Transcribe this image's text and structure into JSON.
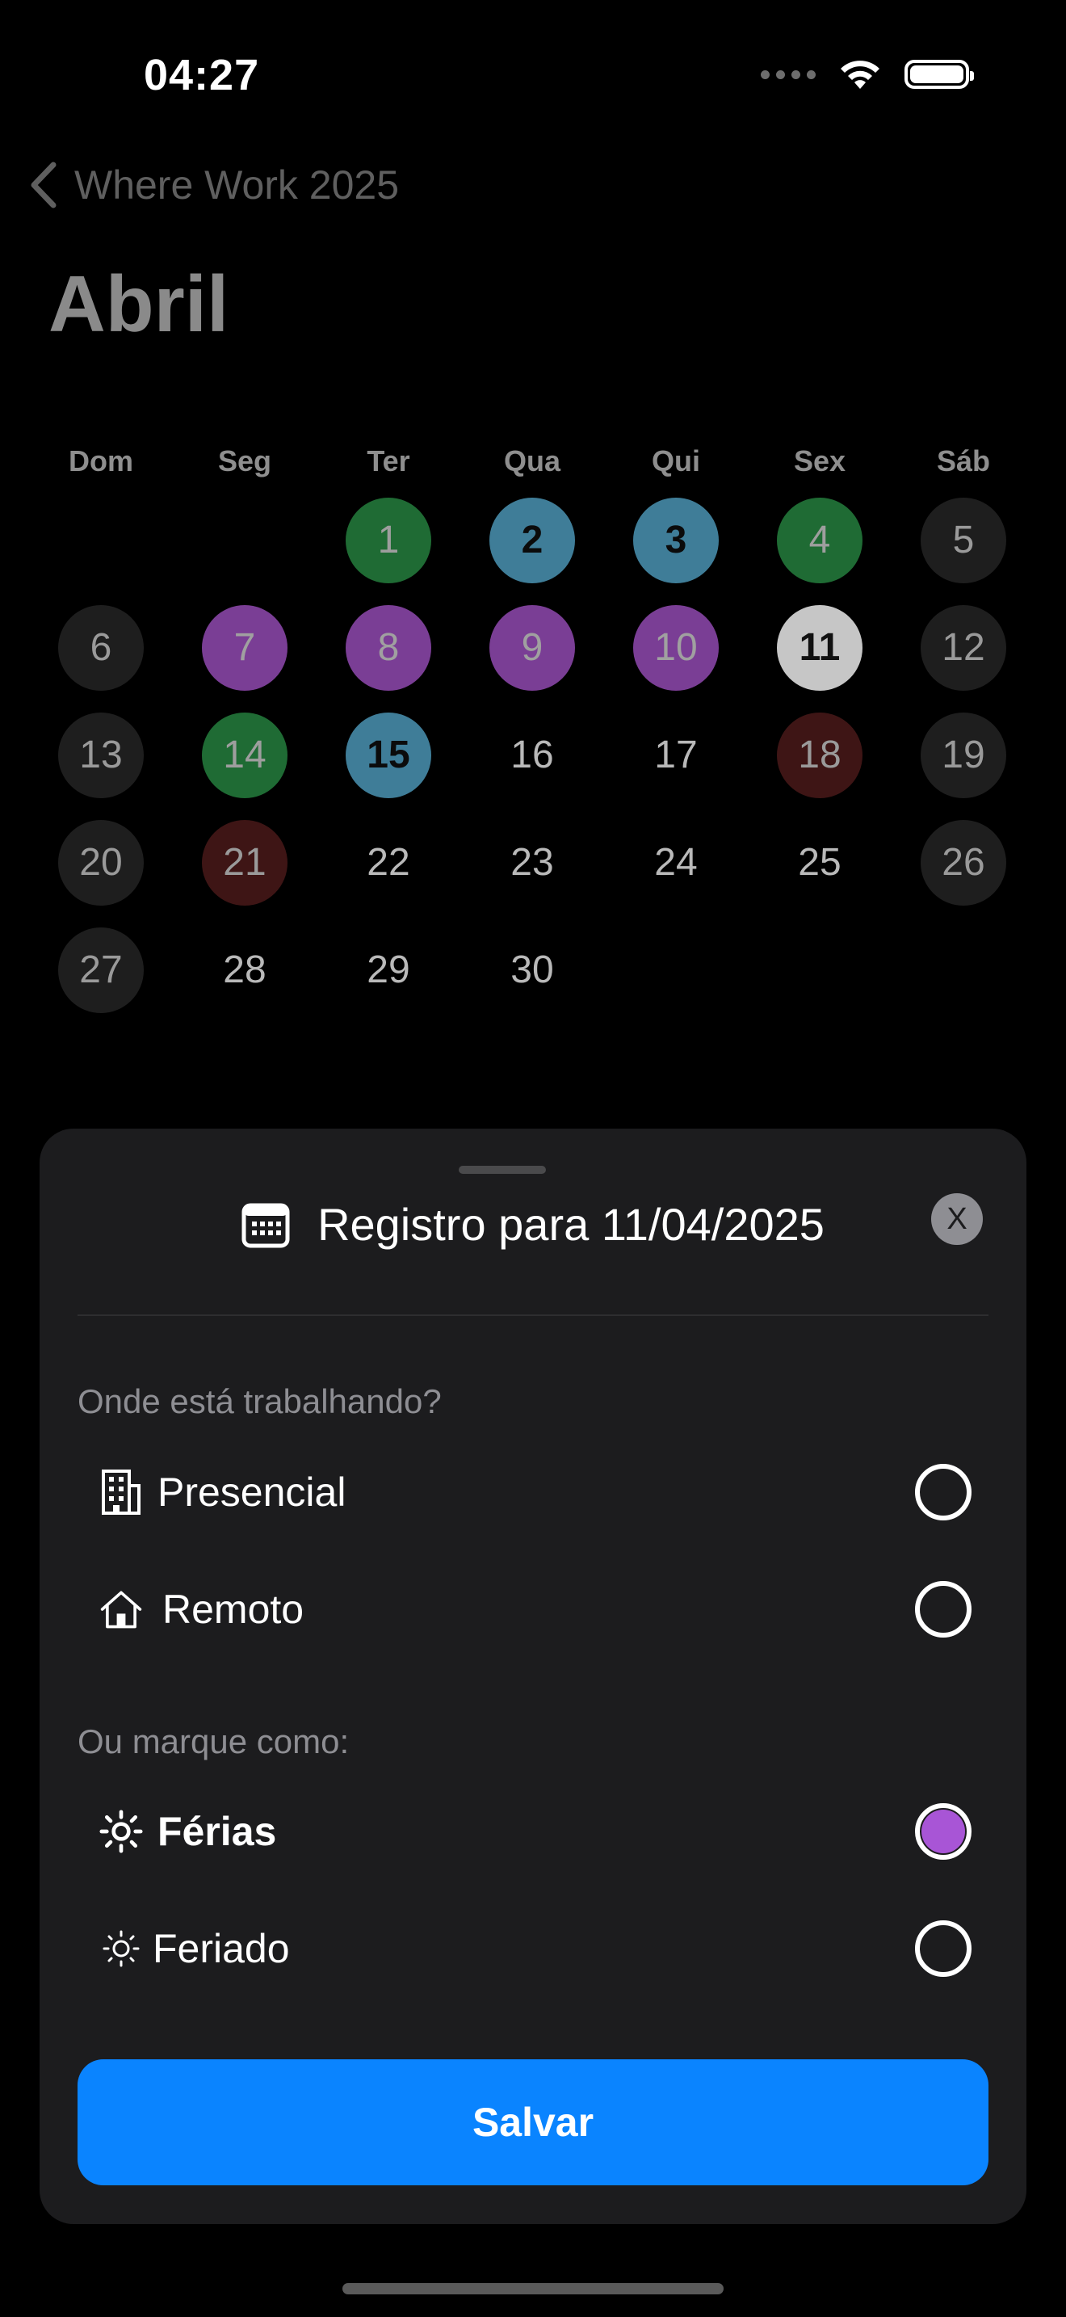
{
  "status_bar": {
    "time": "04:27"
  },
  "nav": {
    "back_label": "Where Work 2025",
    "title": "Abril"
  },
  "calendar": {
    "weekdays": [
      "Dom",
      "Seg",
      "Ter",
      "Qua",
      "Qui",
      "Sex",
      "Sáb"
    ],
    "days": [
      {
        "n": "",
        "s": "empty"
      },
      {
        "n": "",
        "s": "empty"
      },
      {
        "n": "1",
        "s": "green"
      },
      {
        "n": "2",
        "s": "teal"
      },
      {
        "n": "3",
        "s": "teal"
      },
      {
        "n": "4",
        "s": "green"
      },
      {
        "n": "5",
        "s": "weekend"
      },
      {
        "n": "6",
        "s": "weekend"
      },
      {
        "n": "7",
        "s": "purple"
      },
      {
        "n": "8",
        "s": "purple"
      },
      {
        "n": "9",
        "s": "purple"
      },
      {
        "n": "10",
        "s": "purple"
      },
      {
        "n": "11",
        "s": "today"
      },
      {
        "n": "12",
        "s": "weekend"
      },
      {
        "n": "13",
        "s": "weekend"
      },
      {
        "n": "14",
        "s": "green"
      },
      {
        "n": "15",
        "s": "teal"
      },
      {
        "n": "16",
        "s": "plain"
      },
      {
        "n": "17",
        "s": "plain"
      },
      {
        "n": "18",
        "s": "red"
      },
      {
        "n": "19",
        "s": "weekend"
      },
      {
        "n": "20",
        "s": "weekend"
      },
      {
        "n": "21",
        "s": "red"
      },
      {
        "n": "22",
        "s": "plain"
      },
      {
        "n": "23",
        "s": "plain"
      },
      {
        "n": "24",
        "s": "plain"
      },
      {
        "n": "25",
        "s": "plain"
      },
      {
        "n": "26",
        "s": "weekend"
      },
      {
        "n": "27",
        "s": "weekend"
      },
      {
        "n": "28",
        "s": "plain"
      },
      {
        "n": "29",
        "s": "plain"
      },
      {
        "n": "30",
        "s": "plain"
      }
    ]
  },
  "sheet": {
    "title": "Registro para 11/04/2025",
    "close_label": "X",
    "work_question": "Onde está trabalhando?",
    "work_options": [
      {
        "label": "Presencial",
        "icon": "building-icon",
        "selected": false
      },
      {
        "label": "Remoto",
        "icon": "house-icon",
        "selected": false
      }
    ],
    "mark_label": "Ou marque como:",
    "mark_options": [
      {
        "label": "Férias",
        "icon": "sun-icon",
        "selected": true
      },
      {
        "label": "Feriado",
        "icon": "sun-small-icon",
        "selected": false
      }
    ],
    "save_label": "Salvar"
  },
  "colors": {
    "accent": "#0a84ff",
    "vacation": "#a855d6",
    "office": "#1f6b34",
    "remote": "#3f7d98",
    "holiday": "#3e1515",
    "sheet_bg": "#1c1c1e"
  }
}
